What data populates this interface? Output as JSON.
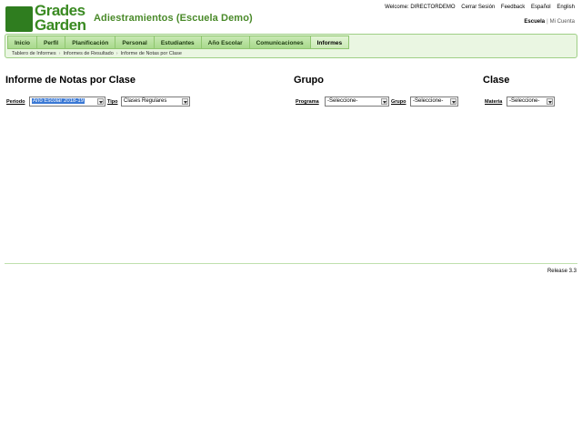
{
  "header": {
    "logo_line1": "Grades",
    "logo_line2": "Garden",
    "site_title": "Adiestramientos (Escuela Demo)",
    "welcome": "Welcome: DIRECTORDEMO",
    "logout": "Cerrar Sesión",
    "feedback": "Feedback",
    "lang_es": "Español",
    "lang_en": "English",
    "scope_school": "Escuela",
    "scope_separator": "|",
    "scope_account": "Mi Cuenta"
  },
  "nav": {
    "tabs": [
      {
        "label": "Inicio"
      },
      {
        "label": "Perfil"
      },
      {
        "label": "Planificación"
      },
      {
        "label": "Personal"
      },
      {
        "label": "Estudiantes"
      },
      {
        "label": "Año Escolar"
      },
      {
        "label": "Comunicaciones"
      },
      {
        "label": "Informes"
      }
    ],
    "breadcrumb": [
      "Tablero de Informes",
      "Informes de Resultado",
      "Informe de Notas por Clase"
    ]
  },
  "main": {
    "title": "Informe de Notas por Clase",
    "group_title": "Grupo",
    "class_title": "Clase",
    "periodo_label": "Periodo",
    "periodo_value": "Año Escolar 2018-19",
    "tipo_label": "Tipo",
    "tipo_value": "Clases Regulares",
    "programa_label": "Programa",
    "programa_value": "-Seleccione-",
    "grupo_label": "Grupo",
    "grupo_value": "-Seleccione-",
    "materia_label": "Materia",
    "materia_value": "-Seleccione-"
  },
  "footer": {
    "release": "Release 3.3"
  },
  "colors": {
    "brand_green": "#3a8a22",
    "nav_bg": "#eaf6e2",
    "selection_blue": "#3a78d4"
  }
}
